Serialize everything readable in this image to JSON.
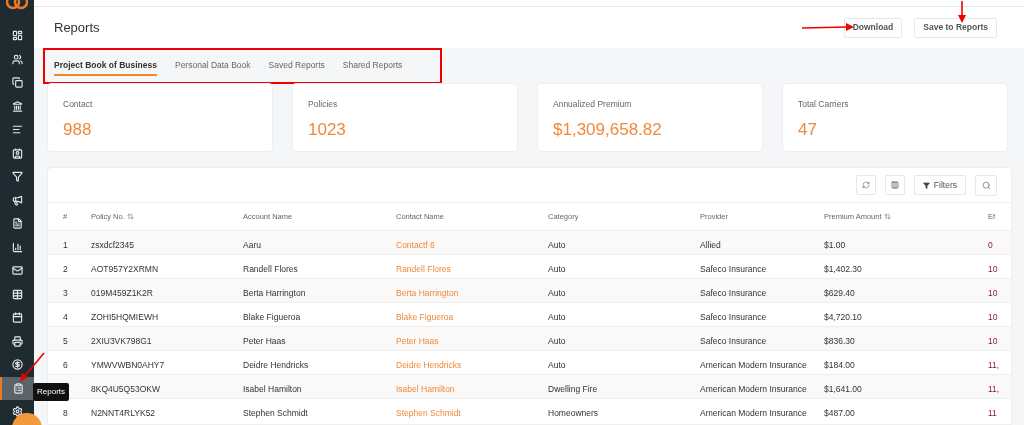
{
  "sidebar": {
    "items": [
      {
        "selected": false
      },
      {
        "selected": false
      },
      {
        "selected": false
      },
      {
        "selected": false
      },
      {
        "selected": false
      },
      {
        "selected": false
      },
      {
        "selected": false
      },
      {
        "selected": false
      },
      {
        "selected": false
      },
      {
        "selected": false
      },
      {
        "selected": false
      },
      {
        "selected": false
      },
      {
        "selected": false
      },
      {
        "selected": false
      },
      {
        "selected": false
      },
      {
        "selected": true
      },
      {
        "selected": false
      }
    ],
    "tooltip": "Reports"
  },
  "page": {
    "title": "Reports",
    "buttons": [
      "Download",
      "Save to Reports"
    ]
  },
  "tabs": [
    {
      "label": "Project Book of Business",
      "selected": true
    },
    {
      "label": "Personal Data Book",
      "selected": false
    },
    {
      "label": "Saved Reports",
      "selected": false
    },
    {
      "label": "Shared Reports",
      "selected": false
    }
  ],
  "stats": [
    {
      "label": "Contact",
      "value": "988"
    },
    {
      "label": "Policies",
      "value": "1023"
    },
    {
      "label": "Annualized Premium",
      "value": "$1,309,658.82"
    },
    {
      "label": "Total Carriers",
      "value": "47"
    }
  ],
  "toolbar": {
    "filters": "Filters"
  },
  "table": {
    "columns": [
      {
        "label": "#",
        "sortable": false
      },
      {
        "label": "Policy No.",
        "sortable": true
      },
      {
        "label": "Account Name",
        "sortable": false
      },
      {
        "label": "Contact Name",
        "sortable": false
      },
      {
        "label": "Category",
        "sortable": false
      },
      {
        "label": "Provider",
        "sortable": false
      },
      {
        "label": "Premium Amount",
        "sortable": true
      },
      {
        "label": "Ef",
        "sortable": false
      }
    ],
    "rows": [
      {
        "cells": [
          "1",
          "zsxdcf2345",
          "Aaru",
          "Contactf 6",
          "Auto",
          "Allied",
          "$1.00",
          "0"
        ]
      },
      {
        "cells": [
          "2",
          "AOT957Y2XRMN",
          "Randell Flores",
          "Randell Flores",
          "Auto",
          "Safeco Insurance",
          "$1,402.30",
          "10"
        ]
      },
      {
        "cells": [
          "3",
          "019M459Z1K2R",
          "Berta Harrington",
          "Berta Harrington",
          "Auto",
          "Safeco Insurance",
          "$629.40",
          "10"
        ]
      },
      {
        "cells": [
          "4",
          "ZOHI5HQMIEWH",
          "Blake Figueroa",
          "Blake Figueroa",
          "Auto",
          "Safeco Insurance",
          "$4,720.10",
          "10"
        ]
      },
      {
        "cells": [
          "5",
          "2XIU3VK798G1",
          "Peter Haas",
          "Peter Haas",
          "Auto",
          "Safeco Insurance",
          "$836.30",
          "10"
        ]
      },
      {
        "cells": [
          "6",
          "YMWVWBN0AHY7",
          "Deidre Hendricks",
          "Deidre Hendricks",
          "Auto",
          "American Modern Insurance",
          "$184.00",
          "11,"
        ]
      },
      {
        "cells": [
          "",
          "8KQ4U5Q53OKW",
          "Isabel Hamilton",
          "Isabel Hamilton",
          "Dwelling Fire",
          "American Modern Insurance",
          "$1,641.00",
          "11,"
        ]
      },
      {
        "cells": [
          "8",
          "N2NNT4RLYK52",
          "Stephen Schmidt",
          "Stephen Schmidt",
          "Homeowners",
          "American Modern Insurance",
          "$487.00",
          "11"
        ]
      }
    ]
  }
}
